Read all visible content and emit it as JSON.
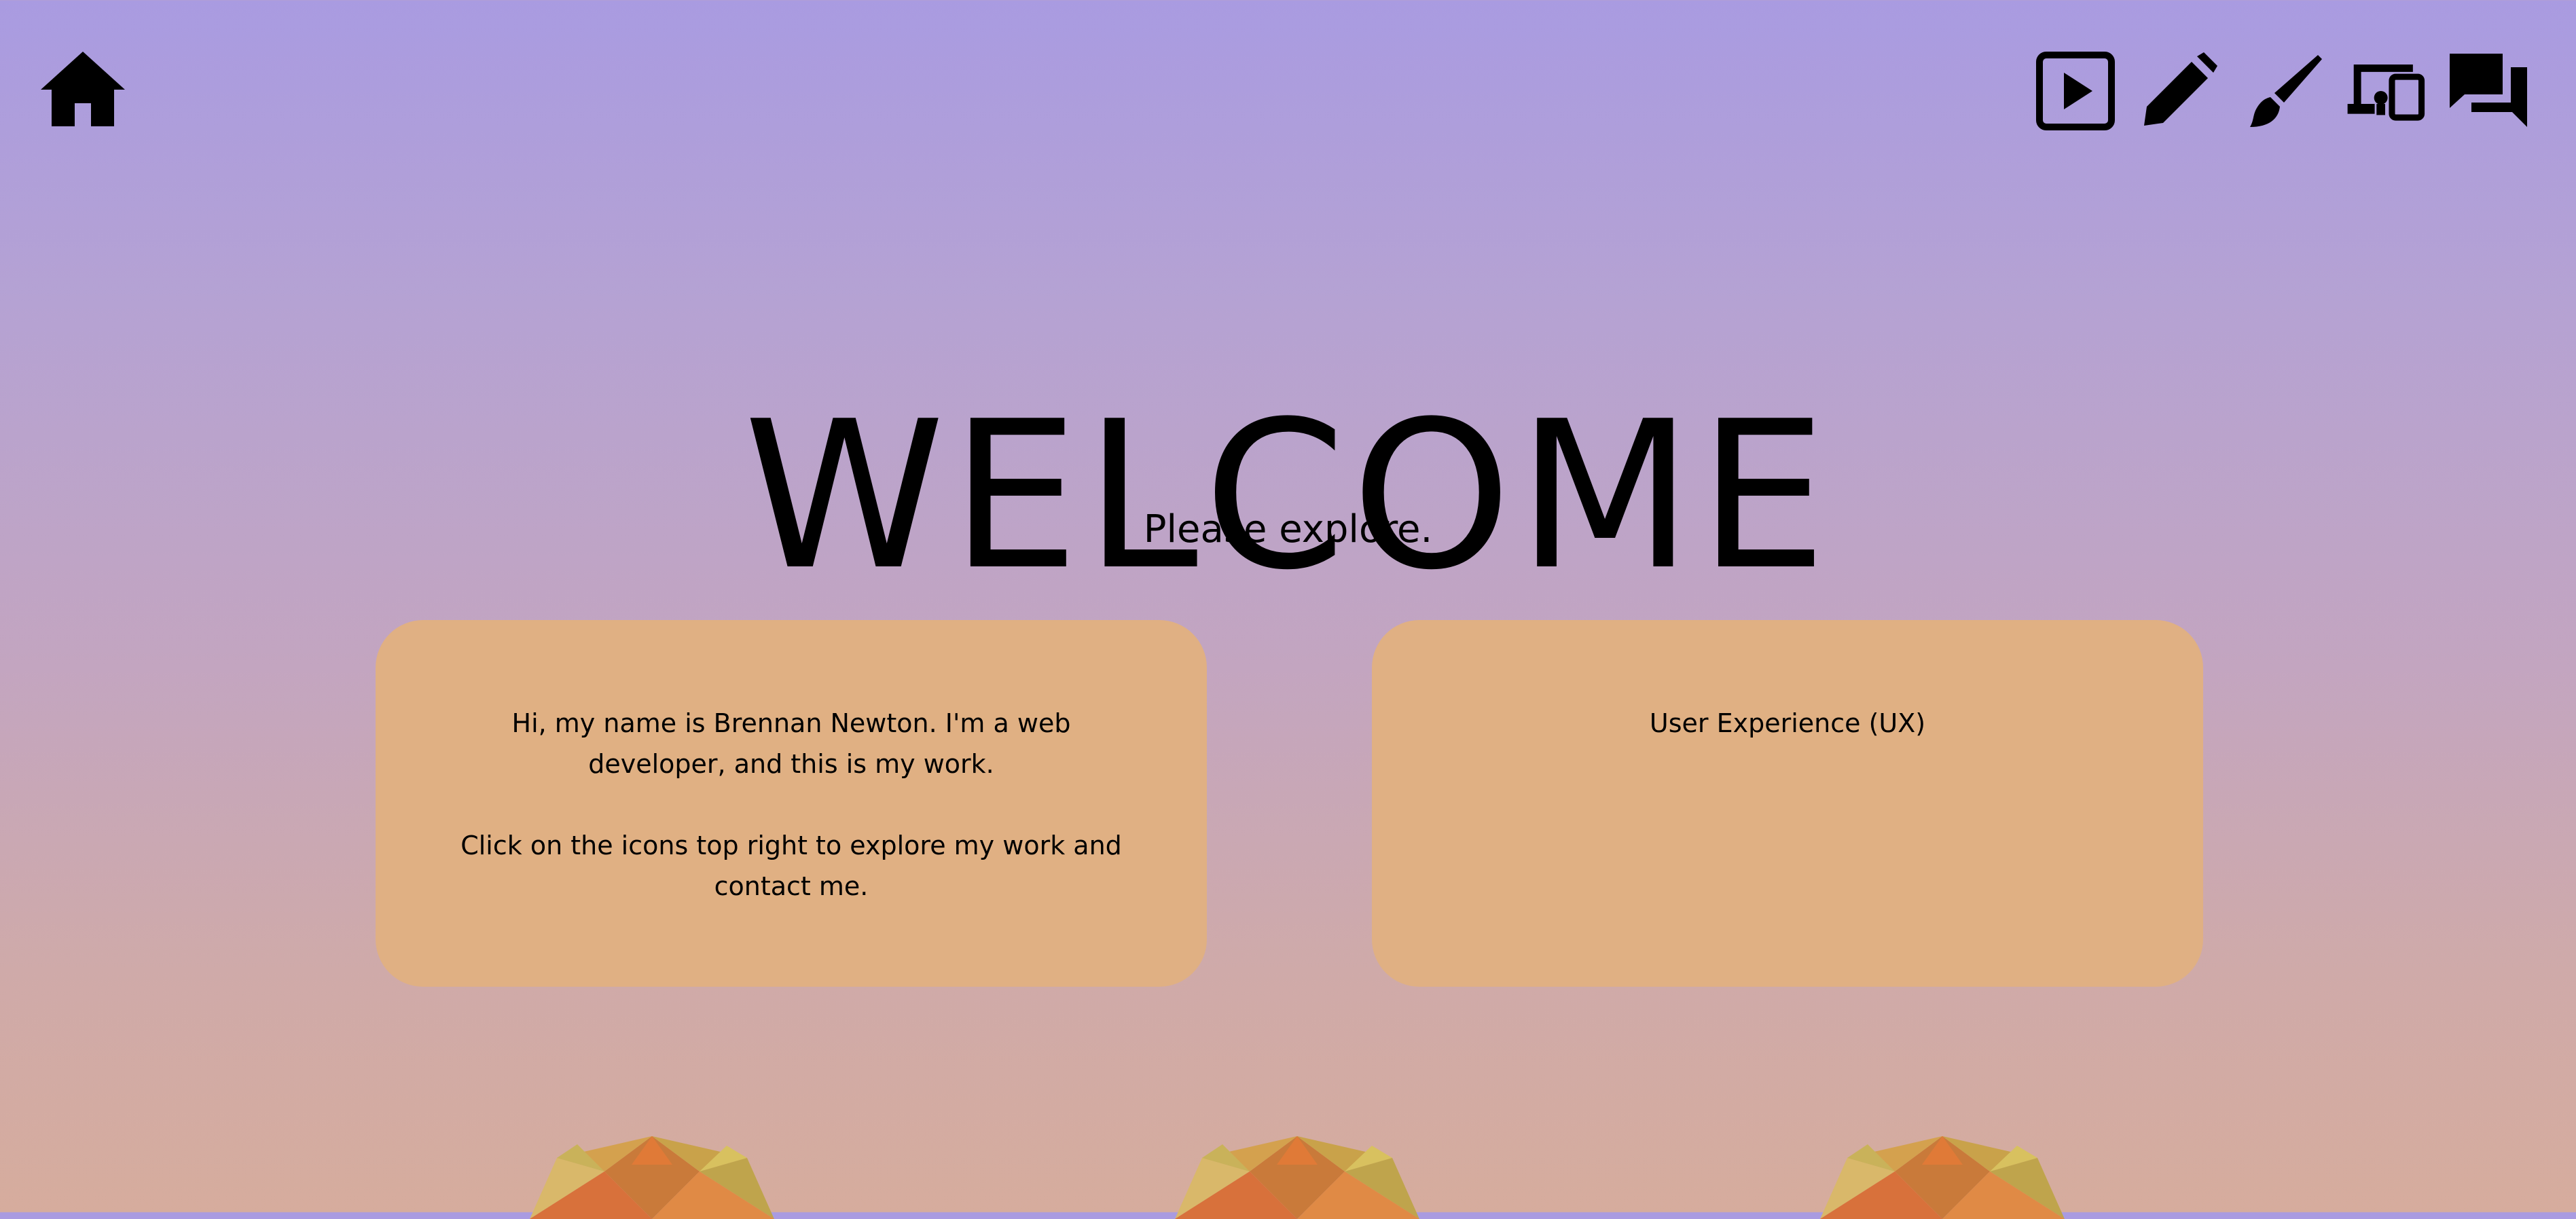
{
  "header": {
    "home_icon": "home-icon",
    "nav_icons": [
      "play-icon",
      "pencil-icon",
      "paintbrush-icon",
      "devices-icon",
      "chat-icon"
    ]
  },
  "hero": {
    "title": "WELCOME",
    "subtitle": "Please explore."
  },
  "cards": {
    "intro": {
      "paragraph1": "Hi, my name is Brennan Newton. I'm a web developer, and this is my work.",
      "paragraph2": "Click on the icons top right to explore my work and contact me."
    },
    "ux": {
      "title": "User Experience (UX)"
    }
  },
  "colors": {
    "card_background": "#e0b083",
    "gradient_top": "#a99be1",
    "gradient_bottom": "#d6ac9d"
  }
}
